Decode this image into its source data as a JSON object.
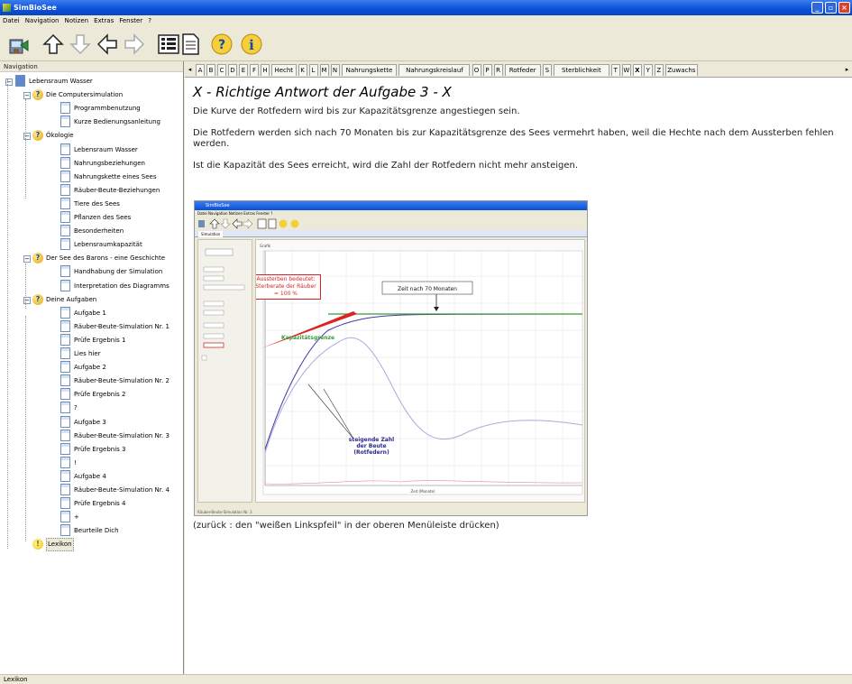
{
  "window": {
    "title": "SimBioSee"
  },
  "menu": [
    "Datei",
    "Navigation",
    "Notizen",
    "Extras",
    "Fenster",
    "?"
  ],
  "toolbar": [
    "home-icon",
    "arrow-up-icon",
    "arrow-down-icon",
    "arrow-left-icon",
    "arrow-right-icon",
    "list-view-icon",
    "page-view-icon",
    "help-icon",
    "info-icon"
  ],
  "nav": {
    "header": "Navigation",
    "items": [
      {
        "label": "Lebensraum Wasser",
        "level": 0,
        "icon": "book"
      },
      {
        "label": "Die Computersimulation",
        "level": 1,
        "icon": "question"
      },
      {
        "label": "Programmbenutzung",
        "level": 2,
        "icon": "doc"
      },
      {
        "label": "Kurze Bedienungsanleitung",
        "level": 2,
        "icon": "doc"
      },
      {
        "label": "Ökologie",
        "level": 1,
        "icon": "question"
      },
      {
        "label": "Lebensraum Wasser",
        "level": 2,
        "icon": "doc"
      },
      {
        "label": "Nahrungsbeziehungen",
        "level": 2,
        "icon": "doc"
      },
      {
        "label": "Nahrungskette eines Sees",
        "level": 2,
        "icon": "doc"
      },
      {
        "label": "Räuber-Beute-Beziehungen",
        "level": 2,
        "icon": "doc"
      },
      {
        "label": "Tiere des Sees",
        "level": 2,
        "icon": "doc"
      },
      {
        "label": "Pflanzen des Sees",
        "level": 2,
        "icon": "doc"
      },
      {
        "label": "Besonderheiten",
        "level": 2,
        "icon": "doc"
      },
      {
        "label": "Lebensraumkapazität",
        "level": 2,
        "icon": "doc"
      },
      {
        "label": "Der See des Barons - eine Geschichte",
        "level": 1,
        "icon": "question"
      },
      {
        "label": "Handhabung der Simulation",
        "level": 2,
        "icon": "doc"
      },
      {
        "label": "Interpretation des Diagramms",
        "level": 2,
        "icon": "doc"
      },
      {
        "label": "Deine Aufgaben",
        "level": 1,
        "icon": "question"
      },
      {
        "label": "Aufgabe 1",
        "level": 2,
        "icon": "doc"
      },
      {
        "label": "Räuber-Beute-Simulation Nr. 1",
        "level": 2,
        "icon": "doc"
      },
      {
        "label": "Prüfe Ergebnis 1",
        "level": 2,
        "icon": "doc"
      },
      {
        "label": "Lies hier",
        "level": 2,
        "icon": "doc"
      },
      {
        "label": "Aufgabe 2",
        "level": 2,
        "icon": "doc"
      },
      {
        "label": "Räuber-Beute-Simulation Nr. 2",
        "level": 2,
        "icon": "doc"
      },
      {
        "label": "Prüfe Ergebnis 2",
        "level": 2,
        "icon": "doc"
      },
      {
        "label": "?",
        "level": 2,
        "icon": "doc"
      },
      {
        "label": "Aufgabe 3",
        "level": 2,
        "icon": "doc"
      },
      {
        "label": "Räuber-Beute-Simulation Nr. 3",
        "level": 2,
        "icon": "doc"
      },
      {
        "label": "Prüfe Ergebnis 3",
        "level": 2,
        "icon": "doc"
      },
      {
        "label": "!",
        "level": 2,
        "icon": "doc"
      },
      {
        "label": "Aufgabe 4",
        "level": 2,
        "icon": "doc"
      },
      {
        "label": "Räuber-Beute-Simulation Nr. 4",
        "level": 2,
        "icon": "doc"
      },
      {
        "label": "Prüfe Ergebnis 4",
        "level": 2,
        "icon": "doc"
      },
      {
        "label": "+",
        "level": 2,
        "icon": "doc"
      },
      {
        "label": "Beurteile Dich",
        "level": 2,
        "icon": "doc"
      },
      {
        "label": "Lexikon",
        "level": 1,
        "icon": "bulb",
        "selected": true
      }
    ]
  },
  "tabs": [
    {
      "label": "A"
    },
    {
      "label": "B"
    },
    {
      "label": "C"
    },
    {
      "label": "D"
    },
    {
      "label": "E"
    },
    {
      "label": "F"
    },
    {
      "label": "H"
    },
    {
      "label": "Hecht"
    },
    {
      "label": "K"
    },
    {
      "label": "L"
    },
    {
      "label": "M"
    },
    {
      "label": "N"
    },
    {
      "label": "Nahrungskette"
    },
    {
      "label": "Nahrungskreislauf"
    },
    {
      "label": "O"
    },
    {
      "label": "P"
    },
    {
      "label": "R"
    },
    {
      "label": "Rotfeder"
    },
    {
      "label": "S"
    },
    {
      "label": "Sterblichkeit"
    },
    {
      "label": "T"
    },
    {
      "label": "W"
    },
    {
      "label": "X",
      "active": true
    },
    {
      "label": "Y"
    },
    {
      "label": "Z"
    },
    {
      "label": "Zuwachs"
    }
  ],
  "content": {
    "title": "X - Richtige Antwort der Aufgabe 3 - X",
    "p1": "Die Kurve der Rotfedern wird bis zur Kapazitätsgrenze angestiegen sein.",
    "p2": "Die Rotfedern werden sich nach 70 Monaten bis zur Kapazitätsgrenze des Sees vermehrt haben, weil die Hechte nach dem Aussterben fehlen werden.",
    "p3": "Ist die Kapazität des Sees erreicht, wird die Zahl der Rotfedern nicht mehr ansteigen.",
    "back_hint": "(zurück : den \"weißen Linkspfeil\" in der oberen Menüleiste drücken)"
  },
  "embedded": {
    "title": "SimBioSee",
    "menu": "Datei  Navigation  Notizen  Extras  Fenster  ?",
    "tab": "Simulation",
    "panel_title": "Grafik",
    "callout_red": "Aussterben bedeutet: Sterberate der Räuber = 100 %",
    "callout_time": "Zeit nach 70 Monaten",
    "label_capacity": "Kapazitätsgrenze",
    "label_prey": "steigende Zahl der Beute (Rotfedern)",
    "axis_x": "Zeit (Monate)",
    "status": "Räuber-Beute-Simulation Nr. 3"
  },
  "statusbar": "Lexikon",
  "colors": {
    "titlebar": "#0a50d8",
    "selection": "#316ac5",
    "capacity": "#3a9a3a",
    "prey": "#3c3ca8",
    "predator": "#aaaadd",
    "callout": "#dd2222"
  }
}
